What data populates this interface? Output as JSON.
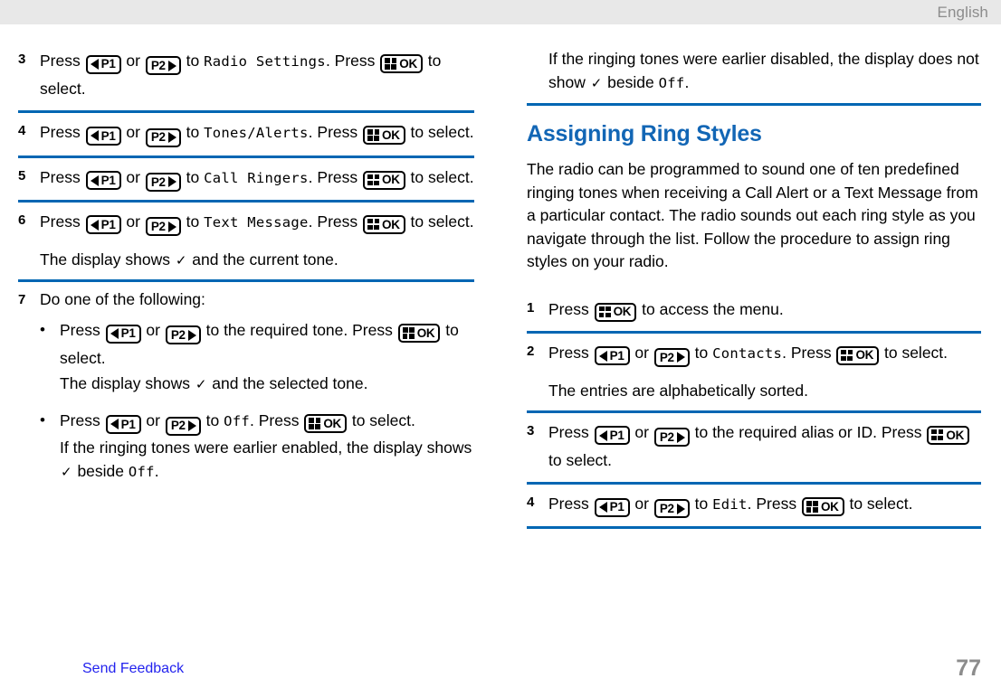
{
  "header": {
    "language": "English"
  },
  "keys": {
    "p1": "P1",
    "p2": "P2",
    "ok": "OK"
  },
  "symbols": {
    "check": "✓",
    "bullet": "•",
    "or": "or",
    "press": "Press",
    "to": "to"
  },
  "left_column": {
    "steps": [
      {
        "num": "3",
        "lines": [
          {
            "parts": [
              {
                "t": "text",
                "v": "Press "
              },
              {
                "t": "key",
                "v": "p1"
              },
              {
                "t": "text",
                "v": " or "
              },
              {
                "t": "key",
                "v": "p2"
              },
              {
                "t": "text",
                "v": " to "
              },
              {
                "t": "lcd",
                "v": "Radio Settings"
              },
              {
                "t": "text",
                "v": ". Press "
              },
              {
                "t": "key",
                "v": "ok"
              },
              {
                "t": "text",
                "v": " to select."
              }
            ]
          }
        ]
      },
      {
        "num": "4",
        "lines": [
          {
            "parts": [
              {
                "t": "text",
                "v": "Press "
              },
              {
                "t": "key",
                "v": "p1"
              },
              {
                "t": "text",
                "v": " or "
              },
              {
                "t": "key",
                "v": "p2"
              },
              {
                "t": "text",
                "v": " to "
              },
              {
                "t": "lcd",
                "v": "Tones/Alerts"
              },
              {
                "t": "text",
                "v": ". Press "
              },
              {
                "t": "key",
                "v": "ok"
              },
              {
                "t": "text",
                "v": " to select."
              }
            ]
          }
        ]
      },
      {
        "num": "5",
        "lines": [
          {
            "parts": [
              {
                "t": "text",
                "v": "Press "
              },
              {
                "t": "key",
                "v": "p1"
              },
              {
                "t": "text",
                "v": " or "
              },
              {
                "t": "key",
                "v": "p2"
              },
              {
                "t": "text",
                "v": " to "
              },
              {
                "t": "lcd",
                "v": "Call Ringers"
              },
              {
                "t": "text",
                "v": ". Press "
              },
              {
                "t": "key",
                "v": "ok"
              },
              {
                "t": "text",
                "v": " to select."
              }
            ]
          }
        ]
      },
      {
        "num": "6",
        "lines": [
          {
            "parts": [
              {
                "t": "text",
                "v": "Press "
              },
              {
                "t": "key",
                "v": "p1"
              },
              {
                "t": "text",
                "v": " or "
              },
              {
                "t": "key",
                "v": "p2"
              },
              {
                "t": "text",
                "v": " to "
              },
              {
                "t": "lcd",
                "v": "Text Message"
              },
              {
                "t": "text",
                "v": ". Press "
              },
              {
                "t": "key",
                "v": "ok"
              },
              {
                "t": "text",
                "v": " to select."
              }
            ]
          },
          {
            "gap": true,
            "parts": [
              {
                "t": "text",
                "v": "The display shows "
              },
              {
                "t": "check",
                "v": "✓"
              },
              {
                "t": "text",
                "v": " and the current tone."
              }
            ]
          }
        ]
      },
      {
        "num": "7",
        "intro": "Do one of the following:",
        "bullets": [
          {
            "parts": [
              {
                "t": "text",
                "v": "Press "
              },
              {
                "t": "key",
                "v": "p1"
              },
              {
                "t": "text",
                "v": " or "
              },
              {
                "t": "key",
                "v": "p2"
              },
              {
                "t": "text",
                "v": " to the required tone. Press "
              },
              {
                "t": "key",
                "v": "ok"
              },
              {
                "t": "text",
                "v": " to select."
              }
            ],
            "note": [
              {
                "t": "text",
                "v": "The display shows "
              },
              {
                "t": "check",
                "v": "✓"
              },
              {
                "t": "text",
                "v": " and the selected tone."
              }
            ]
          },
          {
            "parts": [
              {
                "t": "text",
                "v": "Press "
              },
              {
                "t": "key",
                "v": "p1"
              },
              {
                "t": "text",
                "v": " or "
              },
              {
                "t": "key",
                "v": "p2"
              },
              {
                "t": "text",
                "v": " to "
              },
              {
                "t": "lcd",
                "v": "Off"
              },
              {
                "t": "text",
                "v": ". Press "
              },
              {
                "t": "key",
                "v": "ok"
              },
              {
                "t": "text",
                "v": " to select."
              }
            ],
            "note": [
              {
                "t": "text",
                "v": "If the ringing tones were earlier enabled, the display shows "
              },
              {
                "t": "check",
                "v": "✓"
              },
              {
                "t": "text",
                "v": " beside "
              },
              {
                "t": "lcd",
                "v": "Off"
              },
              {
                "t": "text",
                "v": "."
              }
            ]
          }
        ]
      }
    ]
  },
  "right_column": {
    "continuation": {
      "parts": [
        {
          "t": "text",
          "v": "If the ringing tones were earlier disabled, the display does not show "
        },
        {
          "t": "check",
          "v": "✓"
        },
        {
          "t": "text",
          "v": " beside "
        },
        {
          "t": "lcd",
          "v": "Off"
        },
        {
          "t": "text",
          "v": "."
        }
      ]
    },
    "heading": "Assigning Ring Styles",
    "intro": "The radio can be programmed to sound one of ten predefined ringing tones when receiving a Call Alert or a Text Message from a particular contact. The radio sounds out each ring style as you navigate through the list. Follow the procedure to assign ring styles on your radio.",
    "steps": [
      {
        "num": "1",
        "lines": [
          {
            "parts": [
              {
                "t": "text",
                "v": "Press "
              },
              {
                "t": "key",
                "v": "ok"
              },
              {
                "t": "text",
                "v": " to access the menu."
              }
            ]
          }
        ]
      },
      {
        "num": "2",
        "lines": [
          {
            "parts": [
              {
                "t": "text",
                "v": "Press "
              },
              {
                "t": "key",
                "v": "p1"
              },
              {
                "t": "text",
                "v": " or "
              },
              {
                "t": "key",
                "v": "p2"
              },
              {
                "t": "text",
                "v": " to "
              },
              {
                "t": "lcd",
                "v": "Contacts"
              },
              {
                "t": "text",
                "v": ". Press "
              },
              {
                "t": "key",
                "v": "ok"
              },
              {
                "t": "text",
                "v": " to select."
              }
            ]
          },
          {
            "gap": true,
            "parts": [
              {
                "t": "text",
                "v": "The entries are alphabetically sorted."
              }
            ]
          }
        ]
      },
      {
        "num": "3",
        "lines": [
          {
            "parts": [
              {
                "t": "text",
                "v": "Press "
              },
              {
                "t": "key",
                "v": "p1"
              },
              {
                "t": "text",
                "v": " or "
              },
              {
                "t": "key",
                "v": "p2"
              },
              {
                "t": "text",
                "v": " to the required alias or ID. Press "
              },
              {
                "t": "key",
                "v": "ok"
              },
              {
                "t": "text",
                "v": " to select."
              }
            ]
          }
        ]
      },
      {
        "num": "4",
        "lines": [
          {
            "parts": [
              {
                "t": "text",
                "v": "Press "
              },
              {
                "t": "key",
                "v": "p1"
              },
              {
                "t": "text",
                "v": " or "
              },
              {
                "t": "key",
                "v": "p2"
              },
              {
                "t": "text",
                "v": " to "
              },
              {
                "t": "lcd",
                "v": "Edit"
              },
              {
                "t": "text",
                "v": ". Press "
              },
              {
                "t": "key",
                "v": "ok"
              },
              {
                "t": "text",
                "v": " to select."
              }
            ]
          }
        ]
      }
    ]
  },
  "footer": {
    "send_feedback": "Send Feedback",
    "page_number": "77"
  },
  "colors": {
    "rule_blue": "#0066b3",
    "heading_blue": "#1266b5",
    "link_blue": "#2222ee",
    "header_gray_text": "#8c8c8c",
    "header_band": "#e8e8e8"
  }
}
